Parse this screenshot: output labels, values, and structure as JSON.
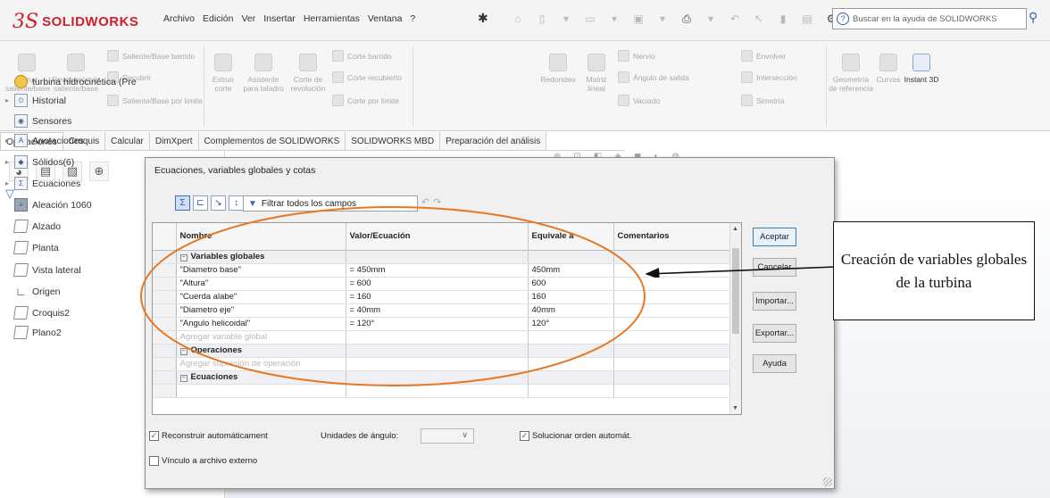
{
  "app": {
    "logo_text": "SOLIDWORKS",
    "menus": [
      "Archivo",
      "Edición",
      "Ver",
      "Insertar",
      "Herramientas",
      "Ventana",
      "?"
    ],
    "search_placeholder": "Buscar en la ayuda de SOLIDWORKS"
  },
  "ribbon": {
    "large_buttons": [
      {
        "label": "Extruir saliente/base"
      },
      {
        "label": "Revolución de saliente/base"
      },
      {
        "label": "Extruir corte"
      },
      {
        "label": "Asistente para taladro"
      },
      {
        "label": "Corte de revolución"
      },
      {
        "label": "Redondeo"
      },
      {
        "label": "Matriz lineal"
      },
      {
        "label": "Geometría de referencia"
      },
      {
        "label": "Curvas"
      },
      {
        "label": "Instant 3D"
      }
    ],
    "small_buttons": [
      {
        "label": "Saliente/Base barrido"
      },
      {
        "label": "Recubrir"
      },
      {
        "label": "Saliente/Base por límite"
      },
      {
        "label": "Corte barrido"
      },
      {
        "label": "Corte recubierto"
      },
      {
        "label": "Corte por límite"
      },
      {
        "label": "Nervio"
      },
      {
        "label": "Ángulo de salida"
      },
      {
        "label": "Vaciado"
      },
      {
        "label": "Envolver"
      },
      {
        "label": "Intersección"
      },
      {
        "label": "Simetría"
      }
    ]
  },
  "tabs": [
    "Operaciones",
    "Croquis",
    "Calcular",
    "DimXpert",
    "Complementos de SOLIDWORKS",
    "SOLIDWORKS MBD",
    "Preparación del análisis"
  ],
  "feature_tree": {
    "items": [
      {
        "label": "turbina hidrocinética  (Pre",
        "expander": false,
        "icon": "part-icon"
      },
      {
        "label": "Historial",
        "expander": true,
        "icon": "history-icon"
      },
      {
        "label": "Sensores",
        "expander": false,
        "icon": "sensor-icon"
      },
      {
        "label": "Anotaciones",
        "expander": true,
        "icon": "annotations-icon"
      },
      {
        "label": "Sólidos(6)",
        "expander": true,
        "icon": "solid-bodies-icon"
      },
      {
        "label": "Ecuaciones",
        "expander": true,
        "icon": "equations-icon"
      },
      {
        "label": "Aleación 1060",
        "expander": false,
        "icon": "material-icon"
      },
      {
        "label": "Alzado",
        "expander": false,
        "icon": "plane-icon"
      },
      {
        "label": "Planta",
        "expander": false,
        "icon": "plane-icon"
      },
      {
        "label": "Vista lateral",
        "expander": false,
        "icon": "plane-icon"
      },
      {
        "label": "Origen",
        "expander": false,
        "icon": "origin-icon"
      },
      {
        "label": "Croquis2",
        "expander": false,
        "icon": "sketch-icon"
      },
      {
        "label": "Plano2",
        "expander": false,
        "icon": "plane-icon"
      }
    ]
  },
  "dialog": {
    "title": "Ecuaciones, variables globales y cotas",
    "filter_label": "Filtrar todos los campos",
    "columns": [
      "Nombre",
      "Valor/Ecuación",
      "Equivale a",
      "Comentarios"
    ],
    "groups": [
      {
        "name": "Variables globales",
        "rows": [
          {
            "name": "\"Diametro base\"",
            "value": "= 450mm",
            "equals": "450mm",
            "comment": ""
          },
          {
            "name": "\"Altura\"",
            "value": "= 600",
            "equals": "600",
            "comment": ""
          },
          {
            "name": "\"Cuerda alabe\"",
            "value": "= 160",
            "equals": "160",
            "comment": ""
          },
          {
            "name": "\"Diametro eje\"",
            "value": "= 40mm",
            "equals": "40mm",
            "comment": ""
          },
          {
            "name": "\"Angulo helicoidal\"",
            "value": "= 120°",
            "equals": "120°",
            "comment": ""
          }
        ],
        "add_placeholder": "Agregar variable global"
      },
      {
        "name": "Operaciones",
        "rows": [],
        "add_placeholder": "Agregar supresión de operación"
      },
      {
        "name": "Ecuaciones",
        "rows": [],
        "add_placeholder": ""
      }
    ],
    "buttons": {
      "accept": "Aceptar",
      "cancel": "Cancelar",
      "import": "Importar...",
      "export": "Exportar...",
      "help": "Ayuda"
    },
    "options": {
      "rebuild_auto": {
        "label": "Reconstruir automáticament",
        "checked": true
      },
      "link_external": {
        "label": "Vínculo a archivo externo",
        "checked": false
      },
      "angle_units_label": "Unidades de ángulo:",
      "solve_order": {
        "label": "Solucionar orden automát.",
        "checked": true
      }
    }
  },
  "annotation": {
    "callout_text": "Creación de variables globales de la turbina",
    "ellipse_color": "#e87722"
  },
  "colors": {
    "brand_red": "#d0202c",
    "accent_blue": "#3466b0"
  }
}
